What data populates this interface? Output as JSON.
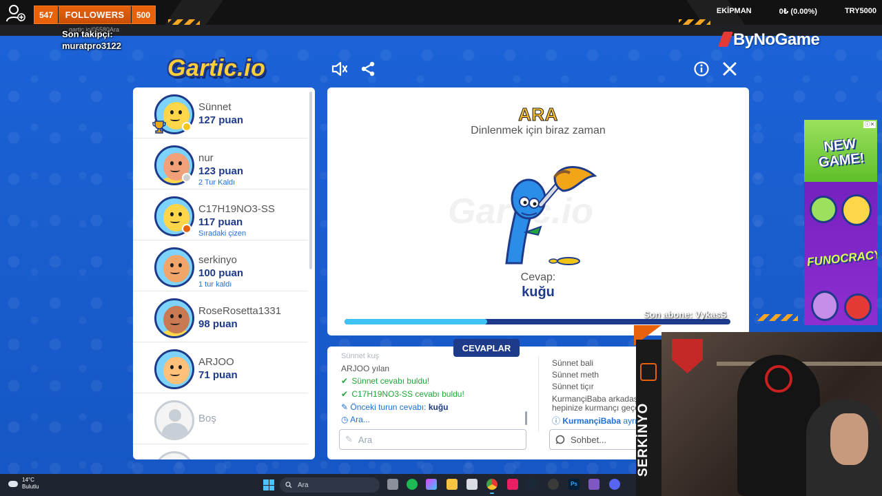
{
  "stream_overlay": {
    "followers_current": "547",
    "followers_label": "FOLLOWERS",
    "followers_goal": "500",
    "last_follower_label": "Son takipçi:",
    "last_follower_name": "muratpro3122",
    "stat_equipment": "EKİPMAN",
    "stat_amount": "0₺ (0.00%)",
    "stat_goal": "TRY5000",
    "brand": "ByNoGame",
    "last_subscriber": "Son abone: VykasS",
    "streamer_name": "SERKİNYO",
    "browser_url": "gartic.io/05580Ara"
  },
  "app": {
    "logo_text": "Gartic.io",
    "icons": [
      "sound-icon",
      "share-icon",
      "info-icon",
      "close-icon"
    ]
  },
  "players": [
    {
      "name": "Sünnet",
      "score": "127 puan",
      "sub": "",
      "status_color": "#f5c51b",
      "skin": "#ffd54a",
      "shirt": "#7dd3fc",
      "trophy": true
    },
    {
      "name": "nur",
      "score": "123 puan",
      "sub": "2 Tur Kaldı",
      "status_color": "#cfcfcf",
      "skin": "#f1a07a",
      "shirt": "#ffd54a",
      "trophy": false
    },
    {
      "name": "C17H19NO3-SS",
      "score": "117 puan",
      "sub": "Sıradaki çizen",
      "status_color": "#e8620c",
      "skin": "#ffd54a",
      "shirt": "#7dd3fc",
      "trophy": false
    },
    {
      "name": "serkinyo",
      "score": "100 puan",
      "sub": "1 tur kaldı",
      "status_color": "",
      "skin": "#f2a56b",
      "shirt": "#7dd3fc",
      "trophy": false
    },
    {
      "name": "RoseRosetta1331",
      "score": "98 puan",
      "sub": "",
      "status_color": "",
      "skin": "#c97a52",
      "shirt": "#ffd54a",
      "trophy": false
    },
    {
      "name": "ARJOO",
      "score": "71 puan",
      "sub": "",
      "status_color": "",
      "skin": "#ffc07a",
      "shirt": "#7dd3fc",
      "trophy": false
    }
  ],
  "empty_slot_label": "Boş",
  "board": {
    "title": "ARA",
    "subtitle": "Dinlenmek için biraz zaman",
    "watermark": "Gartic.io",
    "answer_label": "Cevap:",
    "answer_word": "kuğu",
    "progress": 0.37
  },
  "answers_tab": "CEVAPLAR",
  "answers": {
    "partial_top": "Sünnet kuş",
    "line1_name": "ARJOO",
    "line1_text": "yılan",
    "line2_name": "Sünnet",
    "line2_text": "cevabı buldu!",
    "line3_name": "C17H19NO3-SS",
    "line3_text": "cevabı buldu!",
    "line4_text": "Önceki turun cevabı:",
    "line4_word": "kuğu",
    "line5_text": "Ara...",
    "input_placeholder": "Ara"
  },
  "chat": {
    "l1_name": "Sünnet",
    "l1_text": "bali",
    "l2_name": "Sünnet",
    "l2_text": "meth",
    "l3_name": "Sünnet",
    "l3_text": "tiçır",
    "l4_name": "KurmançiBaba",
    "l4_text": "arkadaşla",
    "l5_text": "hepinize kurmançı geçe",
    "l6_name": "KurmançiBaba",
    "l6_text": "ayrı",
    "input_placeholder": "Sohbet..."
  },
  "ad": {
    "headline": "NEW GAME!",
    "title": "FUNOCRACY"
  },
  "taskbar": {
    "temp": "14°C",
    "weather": "Bulutlu",
    "search": "Ara"
  }
}
